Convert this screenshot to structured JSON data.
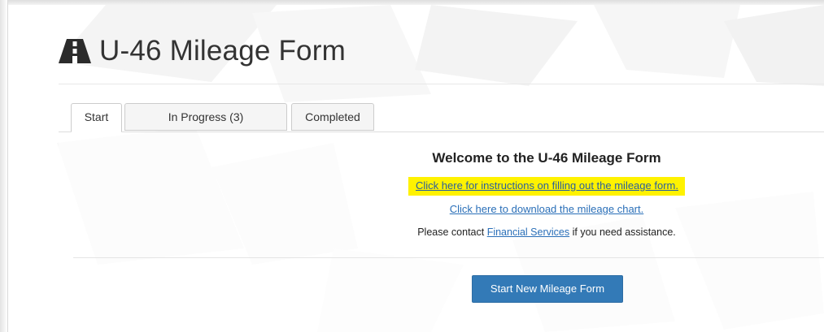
{
  "header": {
    "title": "U-46 Mileage Form",
    "icon": "road-icon"
  },
  "tabs": [
    {
      "label": "Start",
      "active": true
    },
    {
      "label": "In Progress (3)",
      "active": false
    },
    {
      "label": "Completed",
      "active": false
    }
  ],
  "main": {
    "welcome_heading": "Welcome to the U-46 Mileage Form",
    "instructions_link": "Click here for instructions on filling out the mileage form.",
    "chart_link": "Click here to download the mileage chart.",
    "contact_prefix": "Please contact ",
    "contact_link": "Financial Services",
    "contact_suffix": " if you need assistance.",
    "start_button": "Start New Mileage Form"
  },
  "colors": {
    "primary_button": "#337ab7",
    "link": "#2a6fb8",
    "highlight": "#fff200",
    "text": "#333333"
  }
}
